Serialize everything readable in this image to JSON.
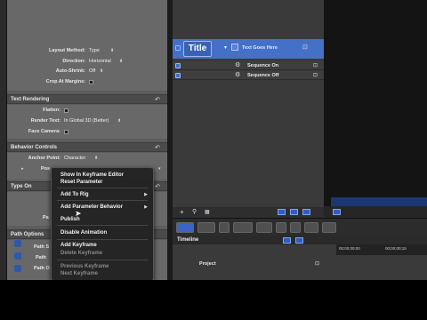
{
  "inspector": {
    "layout_method": {
      "label": "Layout Method:",
      "value": "Type"
    },
    "direction": {
      "label": "Direction:",
      "value": "Horizontal"
    },
    "auto_shrink": {
      "label": "Auto-Shrink:",
      "value": "Off"
    },
    "crop_at_margins": {
      "label": "Crop At Margins:"
    },
    "text_rendering": {
      "title": "Text Rendering",
      "flatten": {
        "label": "Flatten:"
      },
      "render_text": {
        "label": "Render Text:",
        "value": "In Global 3D (Better)"
      },
      "face_camera": {
        "label": "Face Camera:"
      }
    },
    "behavior_controls": {
      "title": "Behavior Controls",
      "anchor_point": {
        "label": "Anchor Point:",
        "value": "Character"
      },
      "position_partial": "Pos"
    },
    "type_on": {
      "title": "Type On",
      "partial": "Pa"
    },
    "path_options": {
      "title": "Path Options",
      "row1": "Path S",
      "row2": "Path",
      "row3": "Path O"
    }
  },
  "layers": {
    "title_layer": {
      "badge": "Title",
      "name": "Text Goes Here"
    },
    "items": [
      {
        "name": "Sequence On"
      },
      {
        "name": "Sequence Off"
      }
    ]
  },
  "context_menu": {
    "items": [
      {
        "label": "Show In Keyframe Editor",
        "enabled": true
      },
      {
        "label": "Reset Parameter",
        "enabled": true
      },
      {
        "label": "Add To Rig",
        "enabled": true,
        "submenu": true
      },
      {
        "label": "Add Parameter Behavior",
        "enabled": true,
        "submenu": true
      },
      {
        "label": "Publish",
        "enabled": true
      },
      {
        "label": "Disable Animation",
        "enabled": true
      },
      {
        "label": "Add Keyframe",
        "enabled": true
      },
      {
        "label": "Delete Keyframe",
        "enabled": false
      },
      {
        "label": "Previous Keyframe",
        "enabled": false
      },
      {
        "label": "Next Keyframe",
        "enabled": false
      }
    ]
  },
  "timeline": {
    "title": "Timeline",
    "project_label": "Project",
    "time_start": "00;00;00;00",
    "time_next": "00;00;00;15"
  },
  "colors": {
    "accent": "#4470c8",
    "panel": "#5d5d5d"
  }
}
